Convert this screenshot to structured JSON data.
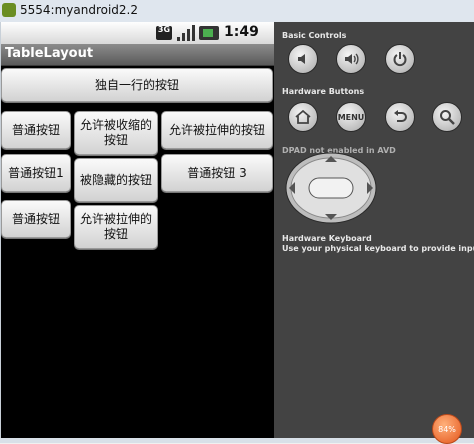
{
  "window": {
    "title": "5554:myandroid2.2"
  },
  "statusbar": {
    "network": "3G",
    "time": "1:49 pm"
  },
  "app": {
    "title": "TableLayout"
  },
  "buttons": {
    "row0": "独自一行的按钮",
    "r1c1": "普通按钮",
    "r1c2": "允许被收缩的按钮",
    "r1c3": "允许被拉伸的按钮",
    "r2c1": "普通按钮1",
    "r2c2": "被隐藏的按钮",
    "r2c3": "普通按钮 3",
    "r3c1": "普通按钮",
    "r3c2": "允许被拉伸的按钮"
  },
  "panel": {
    "basic_controls": "Basic Controls",
    "hardware_buttons": "Hardware Buttons",
    "menu_label": "MENU",
    "dpad_note": "DPAD not enabled in AVD",
    "keyboard_title": "Hardware Keyboard",
    "keyboard_desc": "Use your physical keyboard to provide input"
  },
  "badge": {
    "value": "84%"
  },
  "colors": {
    "panel_bg": "#434343",
    "title_bg": "#6e6e6e",
    "badge": "#e4561c"
  }
}
